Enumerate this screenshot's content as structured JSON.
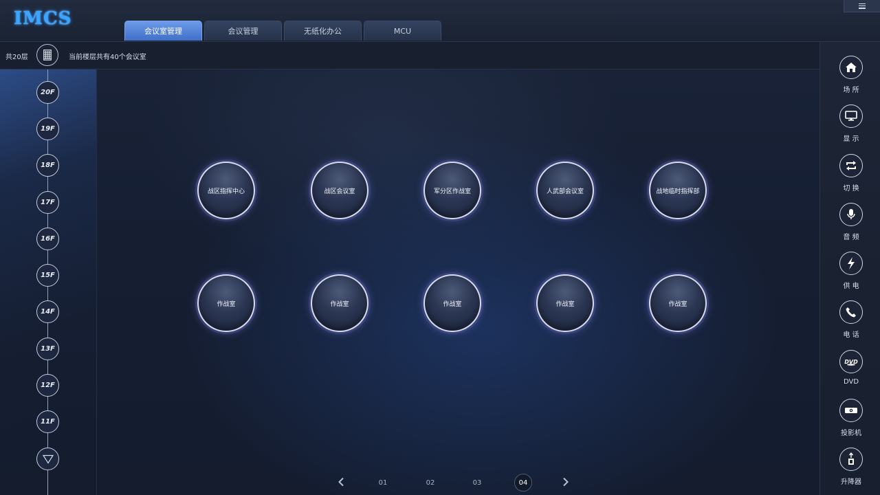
{
  "app": {
    "logo": "IMCS"
  },
  "tabs": [
    {
      "label": "会议室管理",
      "active": true
    },
    {
      "label": "会议管理",
      "active": false
    },
    {
      "label": "无纸化办公",
      "active": false
    },
    {
      "label": "MCU",
      "active": false
    }
  ],
  "subheader": {
    "floor_total": "共20层",
    "floor_info": "当前楼层共有40个会议室"
  },
  "floors": [
    "20F",
    "19F",
    "18F",
    "17F",
    "16F",
    "15F",
    "14F",
    "13F",
    "12F",
    "11F"
  ],
  "rooms": [
    [
      "战区指挥中心",
      "战区会议室",
      "军分区作战室",
      "人武部会议室",
      "战地临时指挥部"
    ],
    [
      "作战室",
      "作战室",
      "作战室",
      "作战室",
      "作战室"
    ]
  ],
  "pagination": {
    "pages": [
      "01",
      "02",
      "03",
      "04"
    ],
    "current": "04"
  },
  "toolbar": [
    {
      "label": "场 所",
      "icon": "home-icon"
    },
    {
      "label": "显 示",
      "icon": "monitor-icon"
    },
    {
      "label": "切 换",
      "icon": "switch-icon"
    },
    {
      "label": "音 频",
      "icon": "microphone-icon"
    },
    {
      "label": "供 电",
      "icon": "lightning-icon"
    },
    {
      "label": "电 话",
      "icon": "phone-icon"
    },
    {
      "label": "DVD",
      "icon": "dvd-icon"
    },
    {
      "label": "投影机",
      "icon": "projector-icon"
    },
    {
      "label": "升降器",
      "icon": "lift-icon"
    }
  ],
  "colors": {
    "accent": "#4f82d8",
    "logo": "#3aa6ff",
    "background": "#141c2e"
  }
}
